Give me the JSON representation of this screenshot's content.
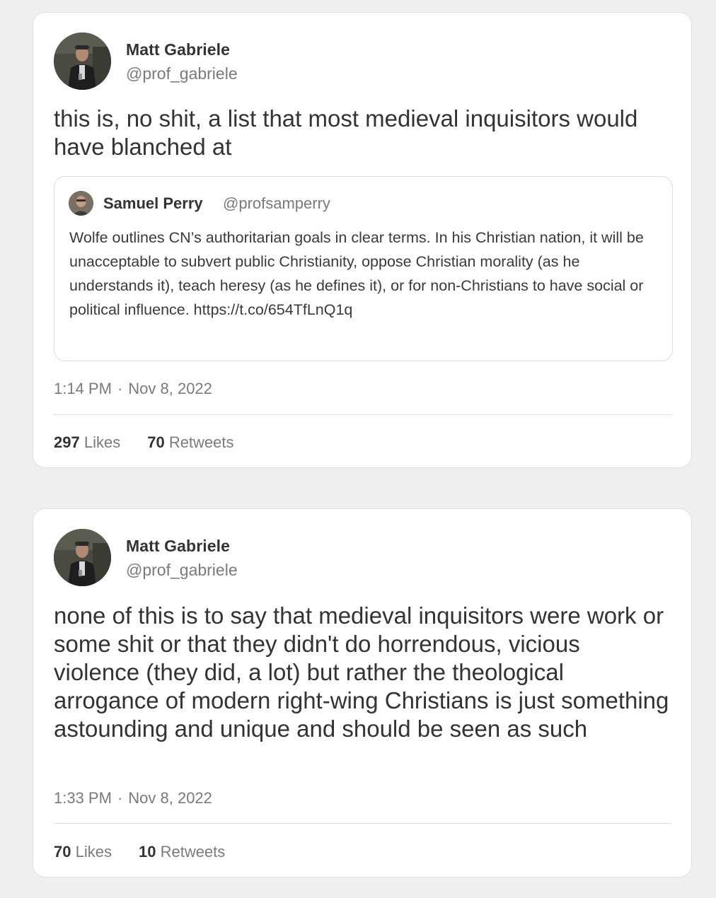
{
  "tweets": [
    {
      "author": {
        "name": "Matt Gabriele",
        "handle": "@prof_gabriele"
      },
      "text": "this is, no shit, a list that most medieval inquisitors would have blanched at",
      "quoted": {
        "author": {
          "name": "Samuel Perry",
          "handle": "@profsamperry"
        },
        "text": "Wolfe outlines CN’s authoritarian goals in clear terms. In his Christian nation, it will be unacceptable to subvert public Christianity, oppose Christian morality (as he understands it), teach heresy (as he defines it), or for non-Christians to have social or political influence. https://t.co/654TfLnQ1q"
      },
      "time": "1:14 PM",
      "separator": "·",
      "date": "Nov 8, 2022",
      "likes_count": "297",
      "likes_label": "Likes",
      "retweets_count": "70",
      "retweets_label": "Retweets"
    },
    {
      "author": {
        "name": "Matt Gabriele",
        "handle": "@prof_gabriele"
      },
      "text": "none of this is to say that medieval inquisitors were work or some shit or that they didn't do horrendous, vicious violence (they did, a lot) but rather the theological arrogance of modern right-wing Christians is just something astounding and unique and should be seen as such",
      "time": "1:33 PM",
      "separator": "·",
      "date": "Nov 8, 2022",
      "likes_count": "70",
      "likes_label": "Likes",
      "retweets_count": "10",
      "retweets_label": "Retweets"
    }
  ],
  "colors": {
    "background": "#efefef",
    "card": "#ffffff",
    "text_primary": "#333333",
    "text_secondary": "#7a7a7a",
    "border": "#e1e1e1"
  }
}
